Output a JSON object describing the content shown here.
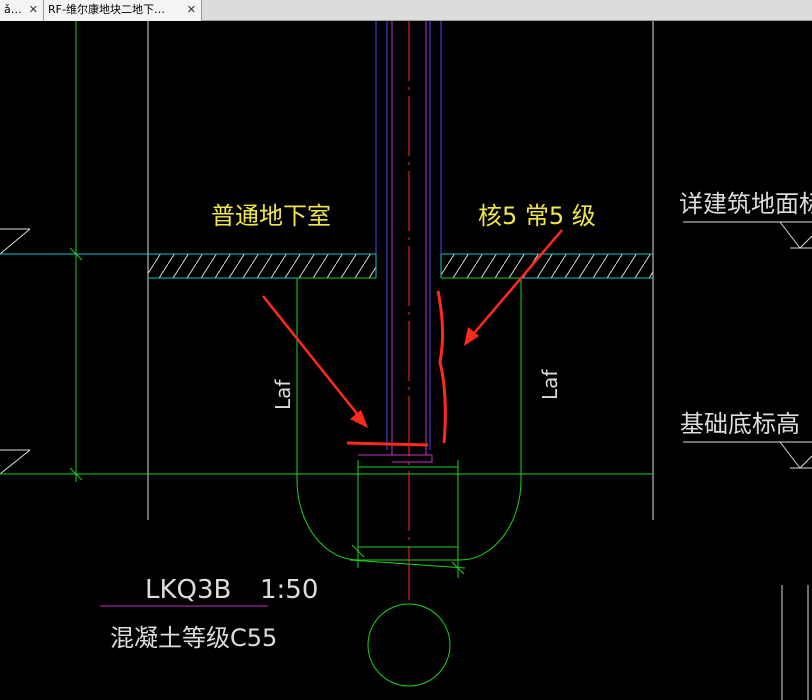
{
  "tabs": [
    {
      "label": "ǎ…"
    },
    {
      "label": "RF-维尔康地块二地下…"
    }
  ],
  "colors": {
    "background": "#000000",
    "green": "#19d219",
    "cyan": "#13c8c8",
    "white": "#dcdcdc",
    "yellow": "#f0e64a",
    "magenta": "#c832c8",
    "blue": "#4646ff",
    "red": "#ff2a1a"
  },
  "drawing": {
    "room_label_left": "普通地下室",
    "room_label_right": "核5 常5 级",
    "level_label_top": "详建筑地面标高",
    "level_label_bottom": "基础底标高",
    "dim_label_left": "Laf",
    "dim_label_right": "Laf",
    "title": "LKQ3B",
    "scale": "1:50",
    "concrete_note": "混凝土等级C55"
  }
}
